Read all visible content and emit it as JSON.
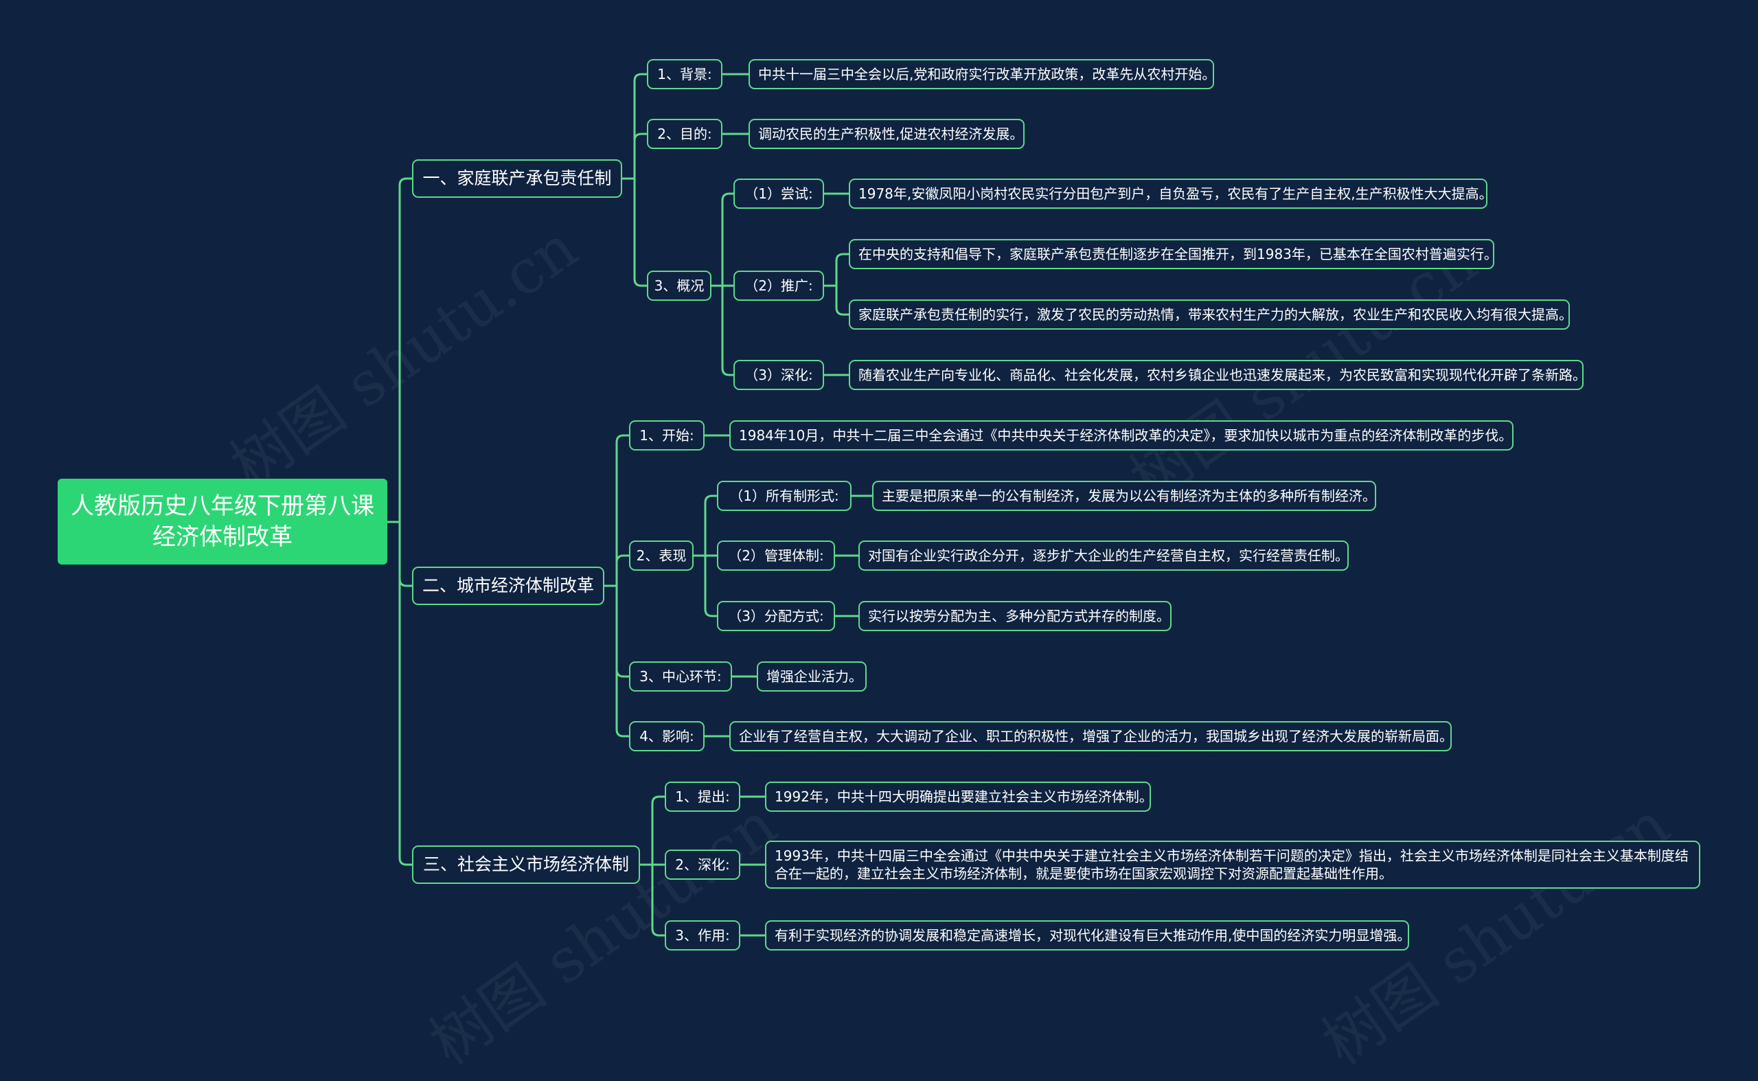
{
  "root": {
    "line1": "人教版历史八年级下册第八课",
    "line2": "经济体制改革"
  },
  "branches": [
    {
      "label": "一、家庭联产承包责任制",
      "items": [
        {
          "label": "1、背景:",
          "text": "中共十一届三中全会以后,党和政府实行改革开放政策，改革先从农村开始。"
        },
        {
          "label": "2、目的:",
          "text": "调动农民的生产积极性,促进农村经济发展。"
        },
        {
          "label": "3、概况",
          "children": [
            {
              "label": "（1）尝试:",
              "texts": [
                "1978年,安徽凤阳小岗村农民实行分田包产到户，自负盈亏，农民有了生产自主权,生产积极性大大提高。"
              ]
            },
            {
              "label": "（2）推广:",
              "texts": [
                "在中央的支持和倡导下，家庭联产承包责任制逐步在全国推开，到1983年，已基本在全国农村普遍实行。",
                "家庭联产承包责任制的实行，激发了农民的劳动热情，带来农村生产力的大解放，农业生产和农民收入均有很大提高。"
              ]
            },
            {
              "label": "（3）深化:",
              "texts": [
                "随着农业生产向专业化、商品化、社会化发展，农村乡镇企业也迅速发展起来，为农民致富和实现现代化开辟了条新路。"
              ]
            }
          ]
        }
      ]
    },
    {
      "label": "二、城市经济体制改革",
      "items": [
        {
          "label": "1、开始:",
          "text": "1984年10月，中共十二届三中全会通过《中共中央关于经济体制改革的决定》，要求加快以城市为重点的经济体制改革的步伐。"
        },
        {
          "label": "2、表现",
          "children": [
            {
              "label": "（1）所有制形式:",
              "texts": [
                "主要是把原来单一的公有制经济，发展为以公有制经济为主体的多种所有制经济。"
              ]
            },
            {
              "label": "（2）管理体制:",
              "texts": [
                "对国有企业实行政企分开，逐步扩大企业的生产经营自主权，实行经营责任制。"
              ]
            },
            {
              "label": "（3）分配方式:",
              "texts": [
                "实行以按劳分配为主、多种分配方式并存的制度。"
              ]
            }
          ]
        },
        {
          "label": "3、中心环节:",
          "text": "增强企业活力。"
        },
        {
          "label": "4、影响:",
          "text": "企业有了经营自主权，大大调动了企业、职工的积极性，增强了企业的活力，我国城乡出现了经济大发展的崭新局面。"
        }
      ]
    },
    {
      "label": "三、社会主义市场经济体制",
      "items": [
        {
          "label": "1、提出:",
          "text": "1992年，中共十四大明确提出要建立社会主义市场经济体制。"
        },
        {
          "label": "2、深化:",
          "text": "1993年，中共十四届三中全会通过《中共中央关于建立社会主义市场经济体制若干问题的决定》指出，社会主义市场经济体制是同社会主义基本制度结合在一起的，建立社会主义市场经济体制，就是要使市场在国家宏观调控下对资源配置起基础性作用。"
        },
        {
          "label": "3、作用:",
          "text": "有利于实现经济的协调发展和稳定高速增长，对现代化建设有巨大推动作用,使中国的经济实力明显增强。"
        }
      ]
    }
  ],
  "watermark": "树图 shutu.cn",
  "colors": {
    "background": "#0f2340",
    "root": "#2dd675",
    "line": "#5fd88b",
    "text": "#ffffff"
  }
}
